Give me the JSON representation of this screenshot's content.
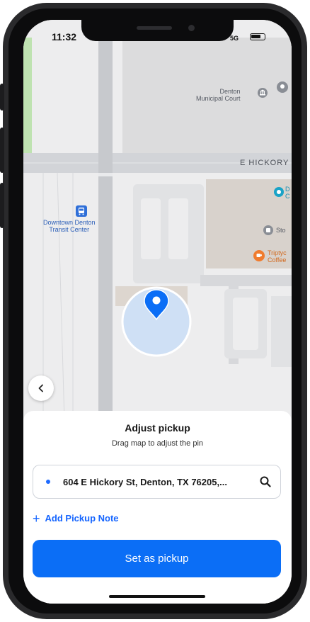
{
  "status_bar": {
    "time": "11:32",
    "network": "5G",
    "battery_icon": "battery-icon"
  },
  "map": {
    "labels": {
      "court_line1": "Denton",
      "court_line2": "Municipal Court",
      "street": "E HICKORY",
      "transit_line1": "Downtown Denton",
      "transit_line2": "Transit Center",
      "poi_d": "D",
      "poi_c": "C",
      "poi_sto": "Sto",
      "coffee_line1": "Triptyc",
      "coffee_line2": "Coffee"
    },
    "pin_color": "#0b6ef6",
    "radius_fill": "#cfe0f5"
  },
  "sheet": {
    "title": "Adjust pickup",
    "subtitle": "Drag map to adjust the pin",
    "address": "604 E Hickory St, Denton, TX 76205,...",
    "add_note": "Add Pickup Note",
    "cta": "Set as pickup"
  },
  "colors": {
    "accent": "#0b6ef6",
    "link": "#1565ff"
  }
}
